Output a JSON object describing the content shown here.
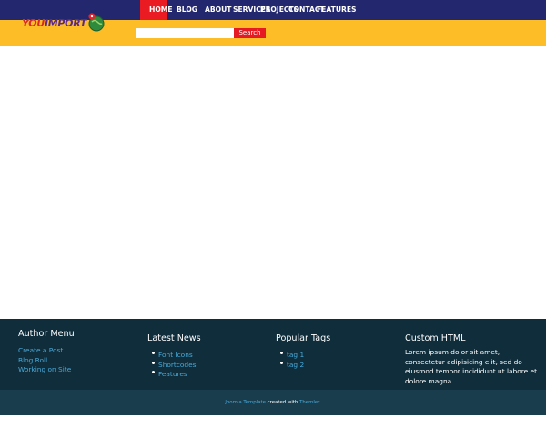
{
  "header": {
    "logo_text_you": "YOU",
    "logo_text_import": "IMPORT",
    "colors": {
      "nav_bg": "#23286e",
      "band_bg": "#fdbd27",
      "active": "#ea1b22"
    }
  },
  "nav": {
    "items": [
      {
        "label": "HOME",
        "active": true
      },
      {
        "label": "BLOG",
        "active": false
      },
      {
        "label": "ABOUT",
        "active": false
      },
      {
        "label": "SERVICES",
        "active": false
      },
      {
        "label": "PROJECTS",
        "active": false
      },
      {
        "label": "CONTACT",
        "active": false
      },
      {
        "label": "FEATURES",
        "active": false
      }
    ]
  },
  "search": {
    "value": "",
    "placeholder": "",
    "button_label": "Search"
  },
  "footer": {
    "author_menu": {
      "title": "Author Menu",
      "items": [
        "Create a Post",
        "Blog Roll",
        "Working on Site"
      ]
    },
    "latest_news": {
      "title": "Latest News",
      "items": [
        "Font Icons",
        "Shortcodes",
        "Features"
      ]
    },
    "popular_tags": {
      "title": "Popular Tags",
      "items": [
        "tag 1",
        "tag 2"
      ]
    },
    "custom_html": {
      "title": "Custom HTML",
      "body": "Lorem ipsum dolor sit amet, consectetur adipisicing elit, sed do eiusmod tempor incididunt ut labore et dolore magna."
    }
  },
  "credit": {
    "link1": "Joomla Template",
    "middle": " created with ",
    "link2": "Themler",
    "end": "."
  }
}
